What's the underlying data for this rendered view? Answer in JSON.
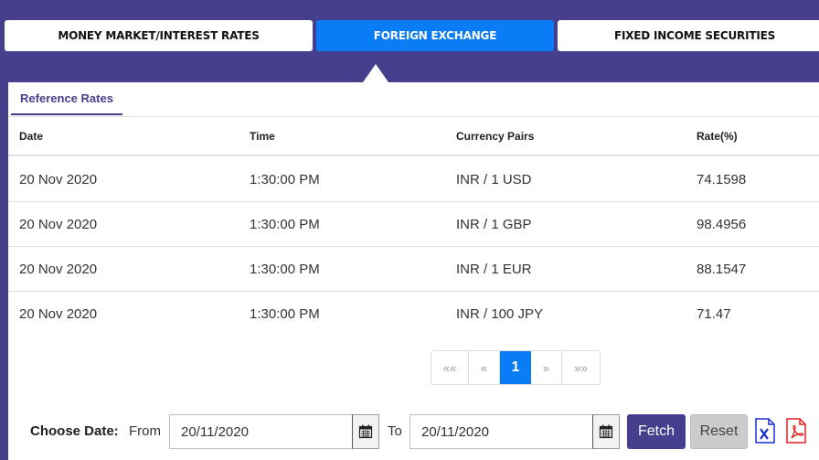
{
  "tabs": [
    {
      "label": "MONEY MARKET/INTEREST RATES"
    },
    {
      "label": "FOREIGN EXCHANGE"
    },
    {
      "label": "FIXED INCOME SECURITIES"
    }
  ],
  "subtab": {
    "label": "Reference Rates"
  },
  "table": {
    "headers": [
      "Date",
      "Time",
      "Currency Pairs",
      "Rate(%)"
    ],
    "rows": [
      [
        "20 Nov 2020",
        "1:30:00 PM",
        "INR / 1 USD",
        "74.1598"
      ],
      [
        "20 Nov 2020",
        "1:30:00 PM",
        "INR / 1 GBP",
        "98.4956"
      ],
      [
        "20 Nov 2020",
        "1:30:00 PM",
        "INR / 1 EUR",
        "88.1547"
      ],
      [
        "20 Nov 2020",
        "1:30:00 PM",
        "INR / 100 JPY",
        "71.47"
      ]
    ]
  },
  "pagination": {
    "first": "««",
    "prev": "«",
    "current": "1",
    "next": "»",
    "last": "»»"
  },
  "date_filter": {
    "choose_label": "Choose Date:",
    "from_label": "From",
    "from_value": "20/11/2020",
    "to_label": "To",
    "to_value": "20/11/2020",
    "fetch_label": "Fetch",
    "reset_label": "Reset"
  },
  "icons": {
    "calendar": "calendar-icon",
    "excel": "excel-export-icon",
    "pdf": "pdf-export-icon"
  },
  "colors": {
    "background": "#463f8d",
    "accent": "#0a7cf5",
    "excel": "#1a2fd6",
    "pdf": "#e02020"
  }
}
